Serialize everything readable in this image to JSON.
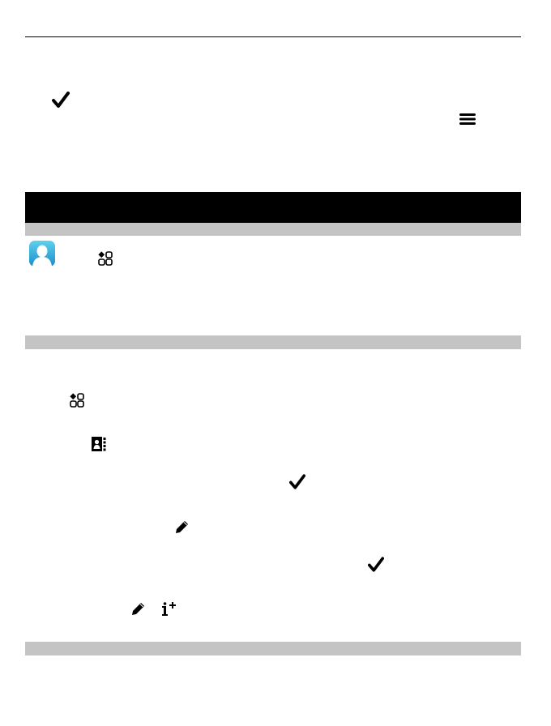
{
  "page": {
    "background": "#ffffff",
    "rule_color": "#000000",
    "banner_color": "#000000",
    "section_bar_color": "#c4c4c4"
  },
  "icons": {
    "top_check": "check-icon",
    "top_menu": "menu-icon",
    "contacts_app": "contacts-app-icon",
    "apps_grid_1": "apps-grid-icon",
    "apps_grid_2": "apps-grid-icon",
    "address_book": "address-book-icon",
    "check_2": "check-icon",
    "edit_1": "pencil-icon",
    "check_3": "check-icon",
    "edit_2": "pencil-icon",
    "add_info": "add-info-icon"
  }
}
